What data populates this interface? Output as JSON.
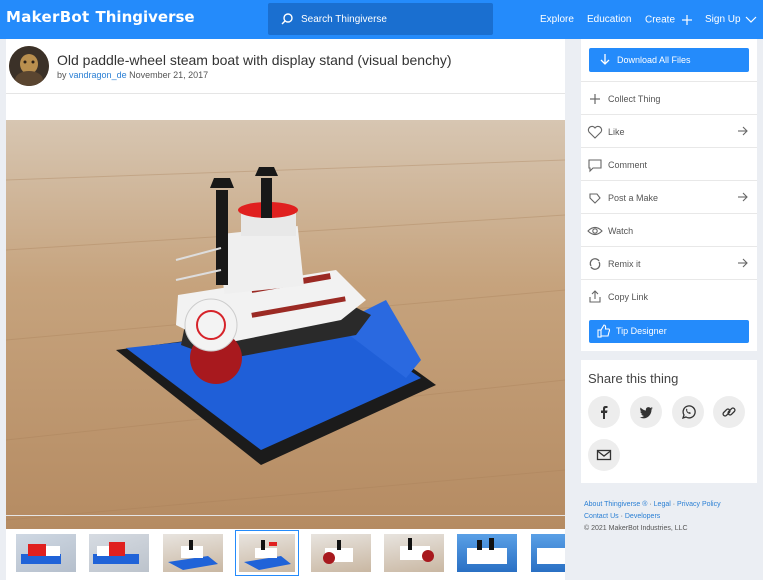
{
  "header": {
    "logo_maker": "MakerBot",
    "logo_thing": "Thingiverse",
    "search_placeholder": "Search Thingiverse",
    "nav": [
      "Explore",
      "Education",
      "Create",
      "Sign Up"
    ]
  },
  "thing": {
    "title": "Old paddle-wheel steam boat with display stand (visual benchy)",
    "by_prefix": "by",
    "author": "vandragon_de",
    "date": "November 21, 2017"
  },
  "sidebar": {
    "download_label": "Download All Files",
    "actions": [
      "Collect Thing",
      "Like",
      "Comment",
      "Post a Make",
      "Watch",
      "Remix it",
      "Copy Link"
    ],
    "tip_label": "Tip Designer"
  },
  "share": {
    "title": "Share this thing",
    "icons": [
      "facebook-icon",
      "twitter-icon",
      "whatsapp-icon",
      "link-icon",
      "email-icon"
    ]
  },
  "footer": {
    "about": "About Thingiverse ®",
    "legal": "Legal",
    "privacy": "Privacy Policy",
    "contact": "Contact Us",
    "developers": "Developers",
    "copyright": "© 2021 MakerBot Industries, LLC",
    "sep": "·"
  },
  "colors": {
    "brand_blue": "#248bfb",
    "boat_red": "#d6232a",
    "stand_blue": "#1e5ed6"
  }
}
